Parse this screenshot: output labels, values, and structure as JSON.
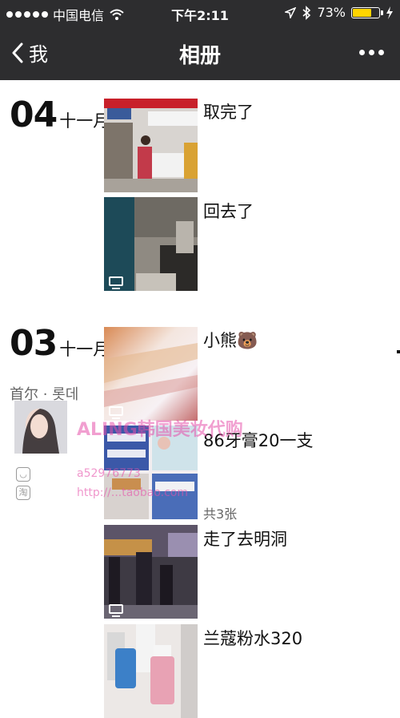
{
  "status_bar": {
    "carrier": "中国电信",
    "time": "下午2:11",
    "battery": "73%",
    "battery_level": 0.73,
    "signal_dots": 5,
    "icons": [
      "wifi-icon",
      "location-arrow-icon",
      "bluetooth-icon",
      "charging-bolt-icon"
    ]
  },
  "nav": {
    "back_label": "我",
    "title": "相册",
    "icons": [
      "chevron-left-icon",
      "more-dots-icon"
    ]
  },
  "groups": [
    {
      "day": "04",
      "month": "十一月",
      "posts": [
        {
          "caption": "取完了",
          "thumb": "airport-counter-photo"
        },
        {
          "caption": "回去了",
          "thumb": "airport-hall-video",
          "is_video": true
        }
      ]
    },
    {
      "day": "03",
      "month": "十一月",
      "posts": [
        {
          "caption": "小熊🐻",
          "thumb": "blurred-light-video",
          "is_video": true
        },
        {
          "caption": "86牙膏20一支",
          "thumb": "toothpaste-shelf-photo",
          "count": "共3张"
        },
        {
          "caption": "走了去明洞",
          "thumb": "street-night-video",
          "is_video": true
        },
        {
          "caption": "兰蔻粉水320",
          "thumb": "cosmetics-bottles-photo"
        }
      ]
    }
  ],
  "shared_profile": {
    "name": "首尔 · 롯데",
    "subtitle": "..."
  },
  "watermark": {
    "brand": "ALING韩国美妆代购",
    "id": "a52976773",
    "url": "http://...taobao.com"
  },
  "colors": {
    "bar": "#2d2d2f",
    "battery": "#ffd400",
    "watermark": "#e650aa"
  }
}
